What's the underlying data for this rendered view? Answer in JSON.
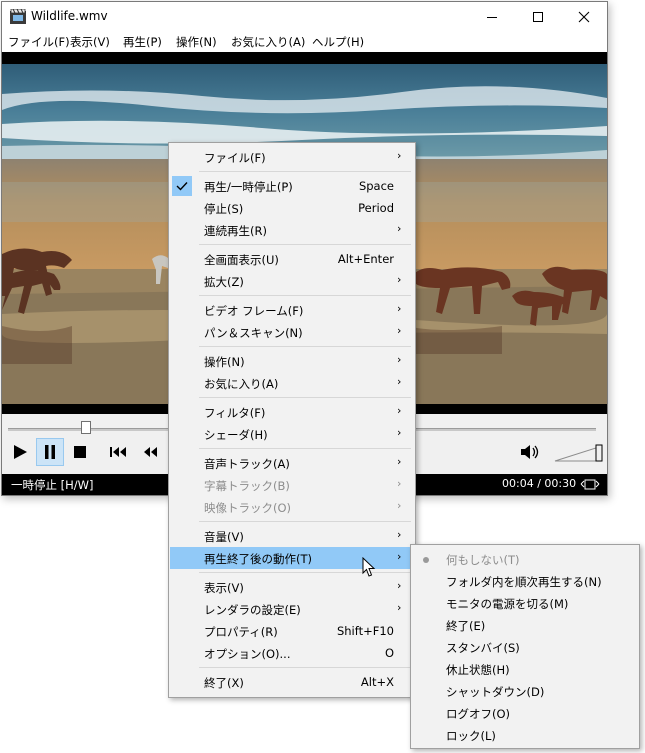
{
  "window": {
    "title": "Wildlife.wmv"
  },
  "menubar": {
    "items": [
      "ファイル(F)",
      "表示(V)",
      "再生(P)",
      "操作(N)",
      "お気に入り(A)",
      "ヘルプ(H)"
    ]
  },
  "controls": {
    "seek_position_fraction": 0.13
  },
  "status": {
    "state": "一時停止 [H/W]",
    "time": "00:04 / 00:30"
  },
  "context_menu": {
    "items": [
      {
        "label": "ファイル(F)",
        "accel": "",
        "submenu": true,
        "checked": false,
        "disabled": false
      },
      {
        "label": "再生/一時停止(P)",
        "accel": "Space",
        "submenu": false,
        "checked": true,
        "disabled": false
      },
      {
        "label": "停止(S)",
        "accel": "Period",
        "submenu": false,
        "checked": false,
        "disabled": false
      },
      {
        "label": "連続再生(R)",
        "accel": "",
        "submenu": true,
        "checked": false,
        "disabled": false
      },
      {
        "label": "全画面表示(U)",
        "accel": "Alt+Enter",
        "submenu": false,
        "checked": false,
        "disabled": false
      },
      {
        "label": "拡大(Z)",
        "accel": "",
        "submenu": true,
        "checked": false,
        "disabled": false
      },
      {
        "label": "ビデオ フレーム(F)",
        "accel": "",
        "submenu": true,
        "checked": false,
        "disabled": false
      },
      {
        "label": "パン＆スキャン(N)",
        "accel": "",
        "submenu": true,
        "checked": false,
        "disabled": false
      },
      {
        "label": "操作(N)",
        "accel": "",
        "submenu": true,
        "checked": false,
        "disabled": false
      },
      {
        "label": "お気に入り(A)",
        "accel": "",
        "submenu": true,
        "checked": false,
        "disabled": false
      },
      {
        "label": "フィルタ(F)",
        "accel": "",
        "submenu": true,
        "checked": false,
        "disabled": false
      },
      {
        "label": "シェーダ(H)",
        "accel": "",
        "submenu": true,
        "checked": false,
        "disabled": false
      },
      {
        "label": "音声トラック(A)",
        "accel": "",
        "submenu": true,
        "checked": false,
        "disabled": false
      },
      {
        "label": "字幕トラック(B)",
        "accel": "",
        "submenu": true,
        "checked": false,
        "disabled": true
      },
      {
        "label": "映像トラック(O)",
        "accel": "",
        "submenu": true,
        "checked": false,
        "disabled": true
      },
      {
        "label": "音量(V)",
        "accel": "",
        "submenu": true,
        "checked": false,
        "disabled": false
      },
      {
        "label": "再生終了後の動作(T)",
        "accel": "",
        "submenu": true,
        "checked": false,
        "disabled": false,
        "highlighted": true
      },
      {
        "label": "表示(V)",
        "accel": "",
        "submenu": true,
        "checked": false,
        "disabled": false
      },
      {
        "label": "レンダラの設定(E)",
        "accel": "",
        "submenu": true,
        "checked": false,
        "disabled": false
      },
      {
        "label": "プロパティ(R)",
        "accel": "Shift+F10",
        "submenu": false,
        "checked": false,
        "disabled": false
      },
      {
        "label": "オプション(O)...",
        "accel": "O",
        "submenu": false,
        "checked": false,
        "disabled": false
      },
      {
        "label": "終了(X)",
        "accel": "Alt+X",
        "submenu": false,
        "checked": false,
        "disabled": false
      }
    ]
  },
  "after_playback_menu": {
    "items": [
      {
        "label": "何もしない(T)",
        "selected": true,
        "disabled": true
      },
      {
        "label": "フォルダ内を順次再生する(N)",
        "selected": false,
        "disabled": false
      },
      {
        "label": "モニタの電源を切る(M)",
        "selected": false,
        "disabled": false
      },
      {
        "label": "終了(E)",
        "selected": false,
        "disabled": false
      },
      {
        "label": "スタンバイ(S)",
        "selected": false,
        "disabled": false
      },
      {
        "label": "休止状態(H)",
        "selected": false,
        "disabled": false
      },
      {
        "label": "シャットダウン(D)",
        "selected": false,
        "disabled": false
      },
      {
        "label": "ログオフ(O)",
        "selected": false,
        "disabled": false
      },
      {
        "label": "ロック(L)",
        "selected": false,
        "disabled": false
      }
    ]
  },
  "colors": {
    "menu_highlight": "#91c9f7",
    "active_button": "#cce4f7",
    "status_bar": "#000000"
  }
}
